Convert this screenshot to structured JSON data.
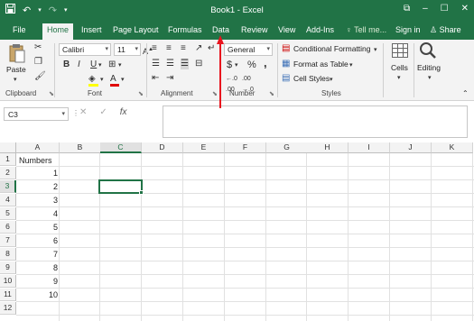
{
  "window": {
    "title": "Book1 - Excel",
    "qat": {
      "save_icon": "save-icon",
      "undo_icon": "undo-icon",
      "redo_icon": "redo-icon",
      "customize_icon": "qat-customize-icon"
    },
    "controls": {
      "restore": "⧉",
      "minimize": "–",
      "maximize": "☐",
      "close": "✕"
    }
  },
  "tabs": {
    "file": "File",
    "home": "Home",
    "insert": "Insert",
    "page_layout": "Page Layout",
    "formulas": "Formulas",
    "data": "Data",
    "review": "Review",
    "view": "View",
    "addins": "Add-Ins",
    "tell_me": "Tell me...",
    "sign_in": "Sign in",
    "share": "Share"
  },
  "ribbon": {
    "clipboard": {
      "label": "Clipboard",
      "paste": "Paste"
    },
    "font": {
      "label": "Font",
      "name": "Calibri",
      "size": "11",
      "bold": "B",
      "italic": "I",
      "underline": "U"
    },
    "alignment": {
      "label": "Alignment"
    },
    "number": {
      "label": "Number",
      "format": "General",
      "currency": "$",
      "percent": "%",
      "comma": ","
    },
    "styles": {
      "label": "Styles",
      "conditional": "Conditional Formatting",
      "format_table": "Format as Table",
      "cell_styles": "Cell Styles"
    },
    "cells": {
      "label": "Cells"
    },
    "editing": {
      "label": "Editing"
    }
  },
  "formula_bar": {
    "name_box": "C3",
    "cancel": "✕",
    "enter": "✓",
    "fx": "fx",
    "content": ""
  },
  "grid": {
    "columns": [
      "A",
      "B",
      "C",
      "D",
      "E",
      "F",
      "G",
      "H",
      "I",
      "J",
      "K"
    ],
    "selected_column": "C",
    "rows": [
      "1",
      "2",
      "3",
      "4",
      "5",
      "6",
      "7",
      "8",
      "9",
      "10",
      "11",
      "12"
    ],
    "selected_row": "3",
    "a_header": "Numbers",
    "a_values": [
      "1",
      "2",
      "3",
      "4",
      "5",
      "6",
      "7",
      "8",
      "9",
      "10"
    ]
  },
  "colors": {
    "brand": "#217346",
    "annotation_arrow": "#e8141e"
  }
}
